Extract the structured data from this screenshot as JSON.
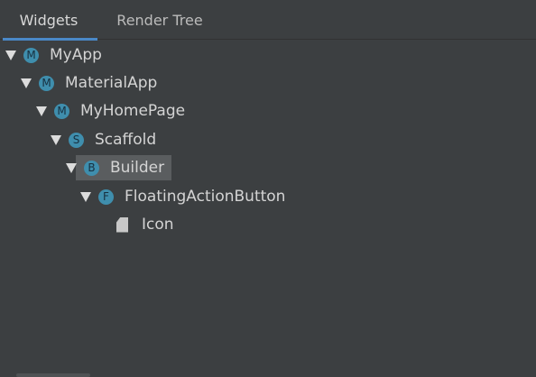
{
  "tabs": {
    "widgets": "Widgets",
    "render_tree": "Render Tree"
  },
  "tree": {
    "nodes": [
      {
        "label": "MyApp",
        "badge": "M"
      },
      {
        "label": "MaterialApp",
        "badge": "M"
      },
      {
        "label": "MyHomePage",
        "badge": "M"
      },
      {
        "label": "Scaffold",
        "badge": "S"
      },
      {
        "label": "Builder",
        "badge": "B",
        "selected": true
      },
      {
        "label": "FloatingActionButton",
        "badge": "F"
      },
      {
        "label": "Icon",
        "icon": "file-icon"
      }
    ]
  },
  "colors": {
    "background": "#3c3f41",
    "accent": "#4a88c7",
    "badge": "#3f8ead",
    "selection": "#5a5d5f"
  }
}
